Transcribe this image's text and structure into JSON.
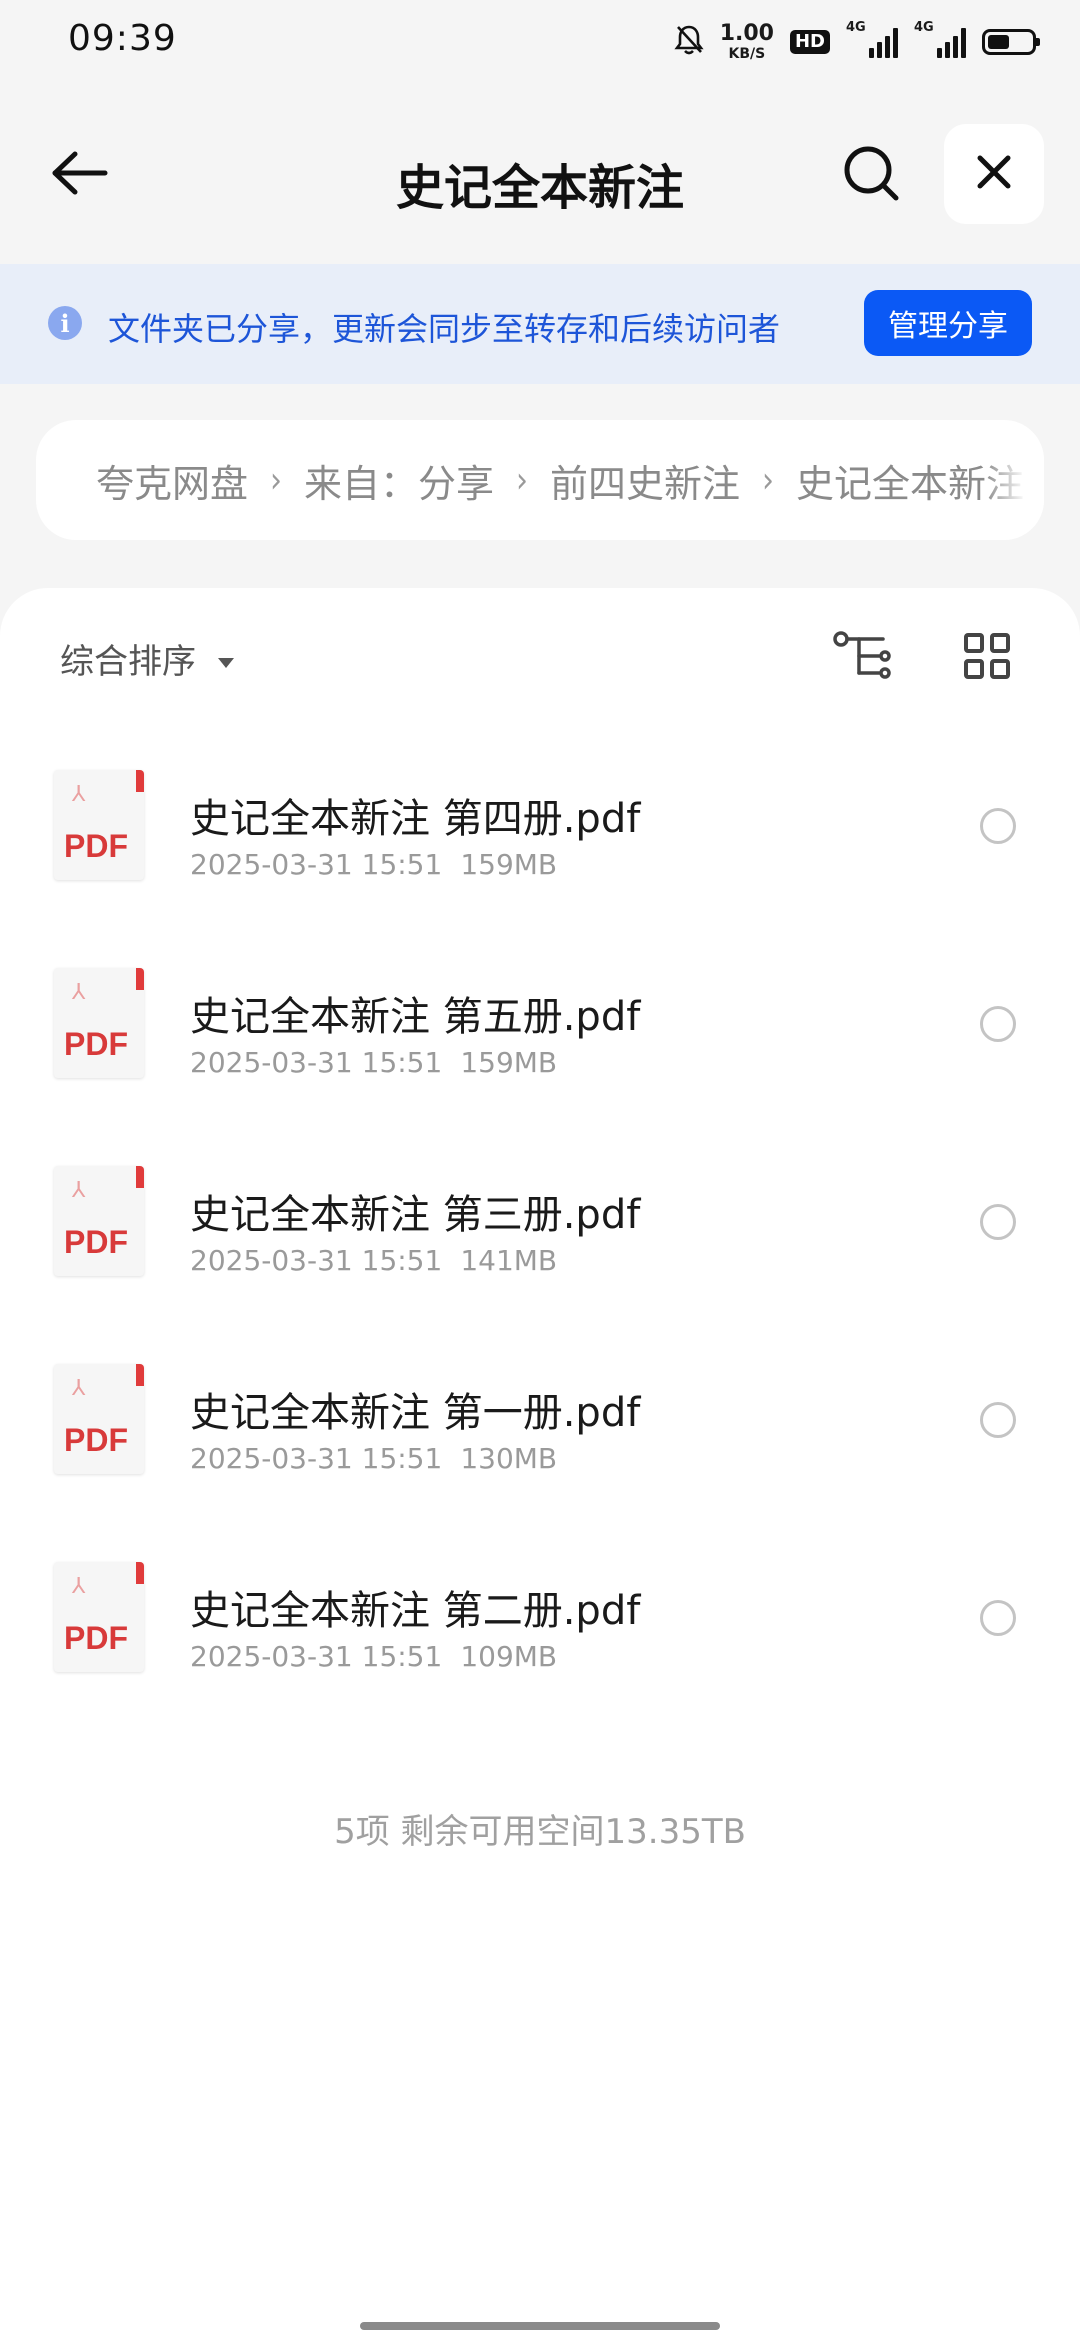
{
  "status_bar": {
    "time": "09:39",
    "net_speed_value": "1.00",
    "net_speed_unit": "KB/S",
    "hd_badge": "HD",
    "signal_1_label": "4G",
    "signal_2_label": "4G",
    "battery_level": 0.5
  },
  "header": {
    "title": "史记全本新注"
  },
  "share_banner": {
    "message": "文件夹已分享，更新会同步至转存和后续访问者",
    "button_label": "管理分享"
  },
  "breadcrumb": {
    "items": [
      "夸克网盘",
      "来自：分享",
      "前四史新注",
      "史记全本新注"
    ],
    "separator": "›"
  },
  "toolbar": {
    "sort_label": "综合排序"
  },
  "files": [
    {
      "name": "史记全本新注 第四册.pdf",
      "date": "2025-03-31 15:51",
      "size": "159MB",
      "icon_label": "PDF"
    },
    {
      "name": "史记全本新注 第五册.pdf",
      "date": "2025-03-31 15:51",
      "size": "159MB",
      "icon_label": "PDF"
    },
    {
      "name": "史记全本新注 第三册.pdf",
      "date": "2025-03-31 15:51",
      "size": "141MB",
      "icon_label": "PDF"
    },
    {
      "name": "史记全本新注 第一册.pdf",
      "date": "2025-03-31 15:51",
      "size": "130MB",
      "icon_label": "PDF"
    },
    {
      "name": "史记全本新注 第二册.pdf",
      "date": "2025-03-31 15:51",
      "size": "109MB",
      "icon_label": "PDF"
    }
  ],
  "summary": "5项 剩余可用空间13.35TB",
  "colors": {
    "accent": "#0b59f5",
    "banner_bg": "#e8eef9",
    "banner_text": "#1d55d8",
    "pdf_red": "#d83a3a"
  }
}
